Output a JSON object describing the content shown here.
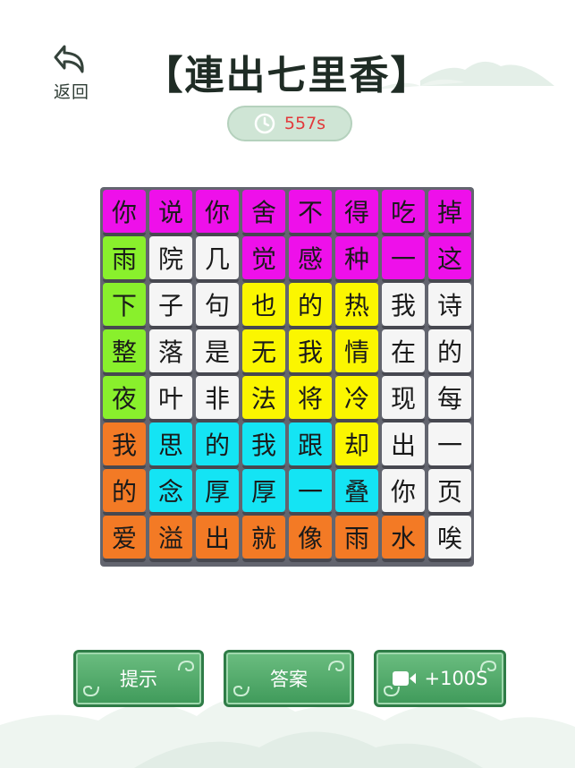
{
  "header": {
    "back_label": "返回",
    "title": "【連出七里香】"
  },
  "timer": {
    "value": "557s"
  },
  "board": {
    "rows": [
      [
        "你",
        "说",
        "你",
        "舍",
        "不",
        "得",
        "吃",
        "掉"
      ],
      [
        "雨",
        "院",
        "几",
        "觉",
        "感",
        "种",
        "一",
        "这"
      ],
      [
        "下",
        "子",
        "句",
        "也",
        "的",
        "热",
        "我",
        "诗"
      ],
      [
        "整",
        "落",
        "是",
        "无",
        "我",
        "情",
        "在",
        "的"
      ],
      [
        "夜",
        "叶",
        "非",
        "法",
        "将",
        "冷",
        "现",
        "每"
      ],
      [
        "我",
        "思",
        "的",
        "我",
        "跟",
        "却",
        "出",
        "一"
      ],
      [
        "的",
        "念",
        "厚",
        "厚",
        "一",
        "叠",
        "你",
        "页"
      ],
      [
        "爱",
        "溢",
        "出",
        "就",
        "像",
        "雨",
        "水",
        "唉"
      ]
    ],
    "colors": [
      [
        "M",
        "M",
        "M",
        "M",
        "M",
        "M",
        "M",
        "M"
      ],
      [
        "G",
        "W",
        "W",
        "M",
        "M",
        "M",
        "M",
        "M"
      ],
      [
        "G",
        "W",
        "W",
        "Y",
        "Y",
        "Y",
        "W",
        "W"
      ],
      [
        "G",
        "W",
        "W",
        "Y",
        "Y",
        "Y",
        "W",
        "W"
      ],
      [
        "G",
        "W",
        "W",
        "Y",
        "Y",
        "Y",
        "W",
        "W"
      ],
      [
        "O",
        "C",
        "C",
        "C",
        "C",
        "Y",
        "W",
        "W"
      ],
      [
        "O",
        "C",
        "C",
        "C",
        "C",
        "C",
        "W",
        "W"
      ],
      [
        "O",
        "O",
        "O",
        "O",
        "O",
        "O",
        "O",
        "W"
      ]
    ],
    "palette": {
      "M": "#ee10ea",
      "G": "#89f02c",
      "W": "#f5f5f5",
      "Y": "#fbf600",
      "O": "#f37a25",
      "C": "#14e4f4"
    }
  },
  "buttons": {
    "hint_label": "提示",
    "answer_label": "答案",
    "video_label": "+100S",
    "video_icon": "video-camera-icon"
  }
}
